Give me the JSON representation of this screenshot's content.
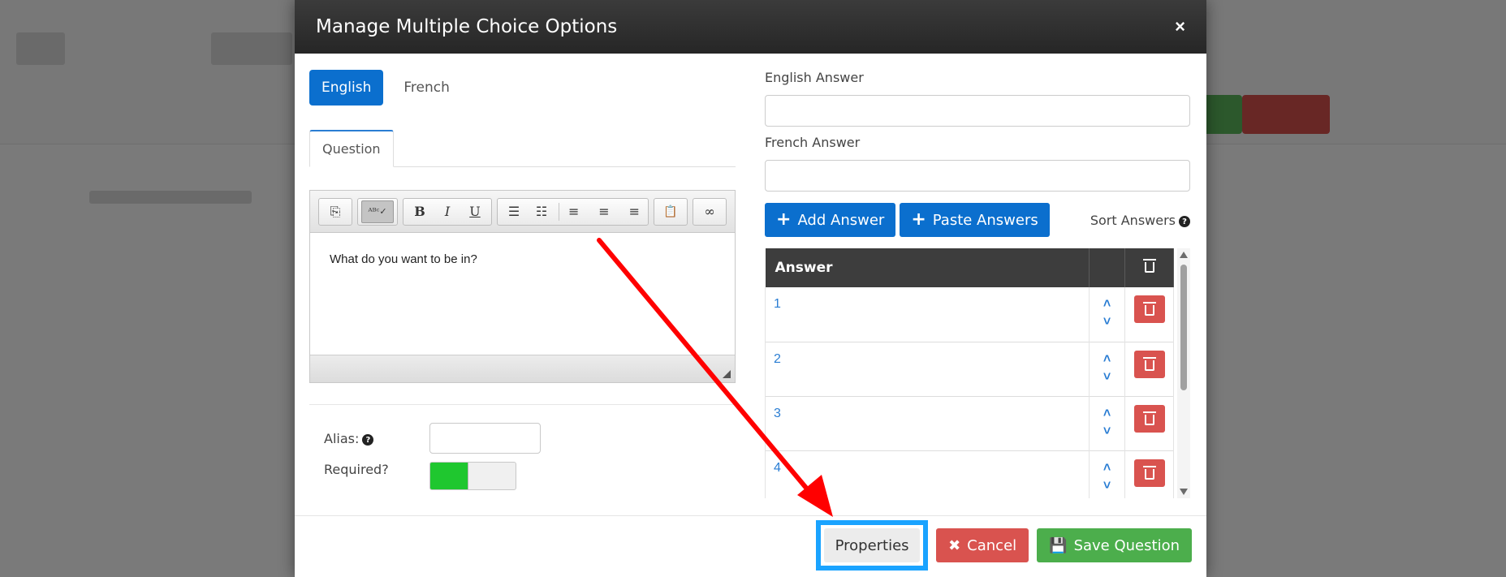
{
  "modal": {
    "title": "Manage Multiple Choice Options",
    "close_glyph": "×"
  },
  "language_tabs": [
    "English",
    "French"
  ],
  "question_tab": "Question",
  "editor": {
    "content": "What do you want to be in?",
    "toolbar": {
      "source": "⎘",
      "spellcheck": "ᴬᴮᶜ✓",
      "bold": "B",
      "italic": "I",
      "underline": "U",
      "numbered_list": "☰",
      "bullet_list": "☷",
      "align_left": "≡",
      "align_center": "≡",
      "align_right": "≡",
      "paste": "📋",
      "link": "∞"
    }
  },
  "form": {
    "alias_label": "Alias:",
    "alias_value": "",
    "required_label": "Required?",
    "required_on": true
  },
  "answers_panel": {
    "english_label": "English Answer",
    "english_value": "",
    "french_label": "French Answer",
    "french_value": "",
    "add_button": "Add Answer",
    "paste_button": "Paste Answers",
    "sort_label": "Sort Answers",
    "column_answer": "Answer",
    "rows": [
      {
        "value": "1"
      },
      {
        "value": "2"
      },
      {
        "value": "3"
      },
      {
        "value": "4"
      }
    ]
  },
  "footer": {
    "properties": "Properties",
    "cancel": "Cancel",
    "save": "Save Question"
  },
  "colors": {
    "primary": "#0b6fce",
    "danger": "#d9534f",
    "success": "#4cae4c",
    "highlight": "#1aa3ff",
    "annotation_arrow": "#ff0000"
  }
}
